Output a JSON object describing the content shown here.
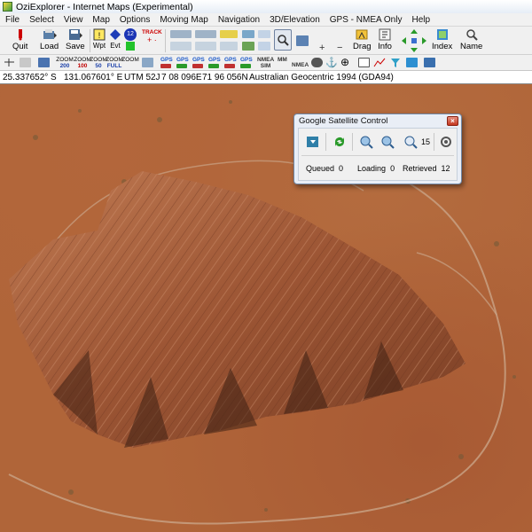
{
  "window": {
    "title": "OziExplorer - Internet Maps (Experimental)"
  },
  "menu": [
    "File",
    "Select",
    "View",
    "Map",
    "Options",
    "Moving Map",
    "Navigation",
    "3D/Elevation",
    "GPS - NMEA Only",
    "Help"
  ],
  "toolbar": {
    "quit_label": "Quit",
    "load_label": "Load",
    "save_label": "Save",
    "wpt_label": "Wpt",
    "evt_label": "Evt",
    "evt_badge": "12",
    "track_label": "TRACK",
    "zoom_value": "100",
    "drag_label": "Drag",
    "info_label": "Info",
    "index_label": "Index",
    "name_label": "Name",
    "zoom_buttons": [
      {
        "top": "ZOOM",
        "bottom": "200"
      },
      {
        "top": "ZOOM",
        "bottom": "100"
      },
      {
        "top": "ZOOM",
        "bottom": "50"
      },
      {
        "top": "ZOOM",
        "bottom": "FULL"
      },
      {
        "top": "ZOOM",
        "bottom": ""
      }
    ],
    "gps_labels": [
      "GPS",
      "GPS",
      "GPS",
      "GPS",
      "GPS",
      "GPS"
    ],
    "nmea_label": "NMEA",
    "sim_label": "SIM",
    "mm_label": "MM",
    "nmea2_label": "NMEA"
  },
  "status": {
    "latitude": "25.337652° S",
    "longitude": "131.067601° E",
    "utm": "UTM  52J",
    "easting": "7 08 096E",
    "northing": "71 96 056N",
    "datum": "Australian Geocentric 1994 (GDA94)"
  },
  "dialog": {
    "title": "Google Satellite Control",
    "close": "×",
    "zoom_level": "15",
    "queued_label": "Queued",
    "queued_value": "0",
    "loading_label": "Loading",
    "loading_value": "0",
    "retrieved_label": "Retrieved",
    "retrieved_value": "12"
  }
}
